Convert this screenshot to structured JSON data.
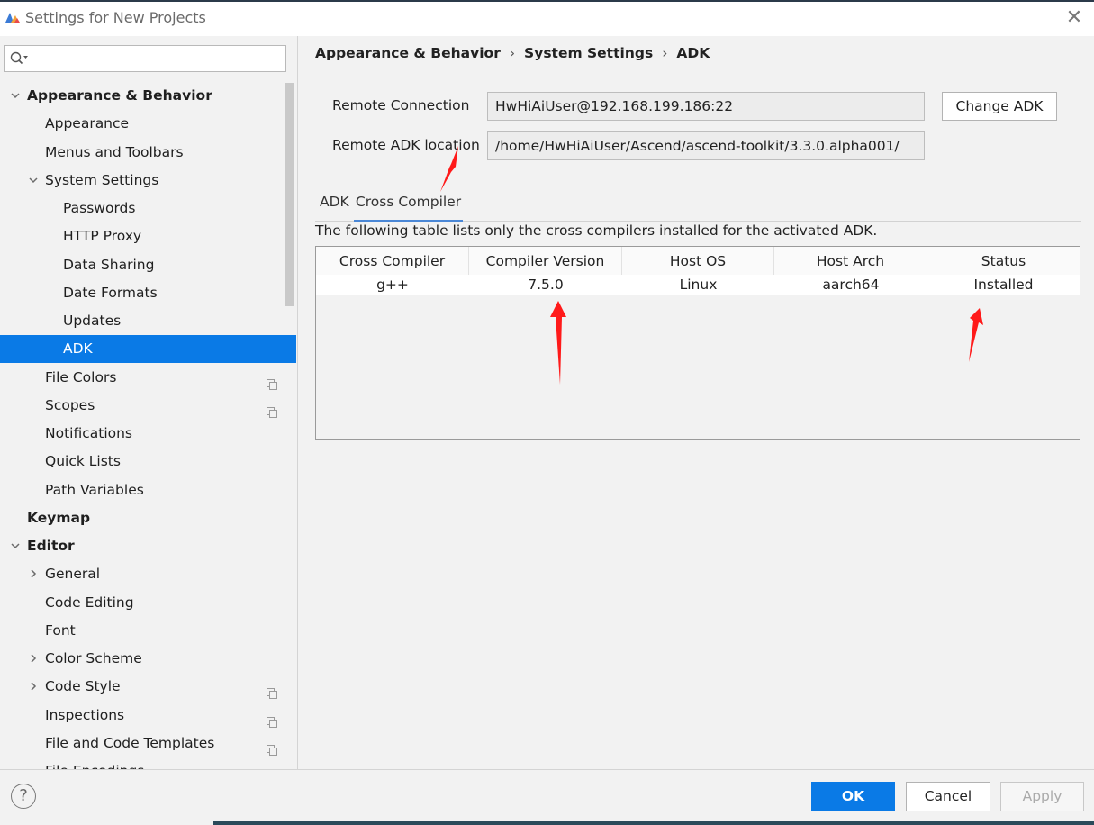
{
  "window": {
    "title": "Settings for New Projects"
  },
  "search": {
    "placeholder": ""
  },
  "sidebar": {
    "items": [
      {
        "label": "Appearance & Behavior",
        "level": 0,
        "arrow": "expanded",
        "bold": true
      },
      {
        "label": "Appearance",
        "level": 1
      },
      {
        "label": "Menus and Toolbars",
        "level": 1
      },
      {
        "label": "System Settings",
        "level": 1,
        "arrow": "expanded"
      },
      {
        "label": "Passwords",
        "level": 2
      },
      {
        "label": "HTTP Proxy",
        "level": 2
      },
      {
        "label": "Data Sharing",
        "level": 2
      },
      {
        "label": "Date Formats",
        "level": 2
      },
      {
        "label": "Updates",
        "level": 2
      },
      {
        "label": "ADK",
        "level": 2,
        "selected": true
      },
      {
        "label": "File Colors",
        "level": 1,
        "copy_icon": true
      },
      {
        "label": "Scopes",
        "level": 1,
        "copy_icon": true
      },
      {
        "label": "Notifications",
        "level": 1
      },
      {
        "label": "Quick Lists",
        "level": 1
      },
      {
        "label": "Path Variables",
        "level": 1
      },
      {
        "label": "Keymap",
        "level": 0,
        "bold": true
      },
      {
        "label": "Editor",
        "level": 0,
        "arrow": "expanded",
        "bold": true
      },
      {
        "label": "General",
        "level": 1,
        "arrow": "collapsed"
      },
      {
        "label": "Code Editing",
        "level": 1
      },
      {
        "label": "Font",
        "level": 1
      },
      {
        "label": "Color Scheme",
        "level": 1,
        "arrow": "collapsed"
      },
      {
        "label": "Code Style",
        "level": 1,
        "arrow": "collapsed",
        "copy_icon": true
      },
      {
        "label": "Inspections",
        "level": 1,
        "copy_icon": true
      },
      {
        "label": "File and Code Templates",
        "level": 1,
        "copy_icon": true
      },
      {
        "label": "File Encodings",
        "level": 1,
        "copy_icon": true
      }
    ]
  },
  "breadcrumb": [
    "Appearance & Behavior",
    "System Settings",
    "ADK"
  ],
  "connection": {
    "remote_label": "Remote Connection",
    "remote_value": "HwHiAiUser@192.168.199.186:22",
    "location_label": "Remote ADK location",
    "location_value": "/home/HwHiAiUser/Ascend/ascend-toolkit/3.3.0.alpha001/",
    "change_button": "Change ADK"
  },
  "tabs": [
    {
      "label": "ADK",
      "active": false
    },
    {
      "label": "Cross Compiler",
      "active": true
    }
  ],
  "description": "The following table lists only the cross compilers installed for the activated ADK.",
  "table": {
    "columns": [
      "Cross Compiler",
      "Compiler Version",
      "Host OS",
      "Host Arch",
      "Status"
    ],
    "rows": [
      [
        "g++",
        "7.5.0",
        "Linux",
        "aarch64",
        "Installed"
      ]
    ]
  },
  "footer": {
    "ok": "OK",
    "cancel": "Cancel",
    "apply": "Apply",
    "help": "?"
  },
  "colors": {
    "accent": "#0a7ae6",
    "annotation": "#ff1a1a"
  },
  "icons": {
    "app": "app-logo-icon",
    "close": "close-icon",
    "search": "search-icon",
    "expand": "chevron-down-icon",
    "collapse": "chevron-right-icon",
    "copy": "copy-settings-icon",
    "help": "help-icon"
  }
}
